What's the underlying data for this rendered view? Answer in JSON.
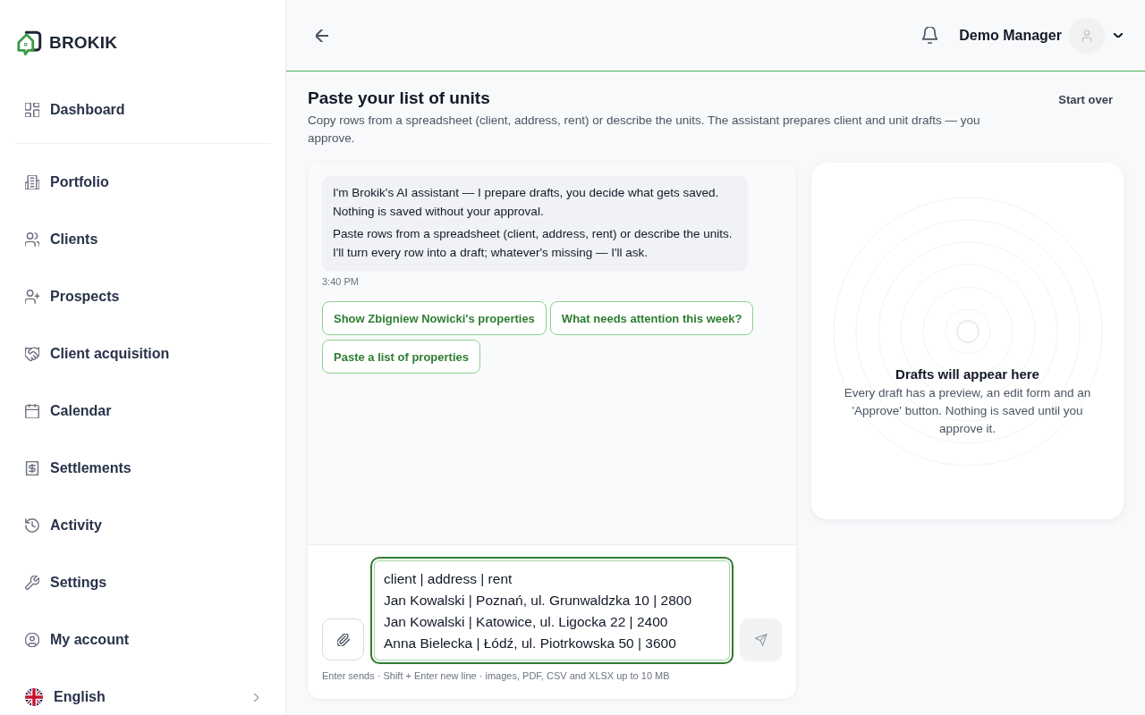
{
  "sidebar": {
    "logo": {
      "text": "BROKIK"
    },
    "nav_groups": [
      {
        "items": [
          {
            "label": "Dashboard",
            "selected": false
          }
        ]
      },
      {
        "items": [
          {
            "label": "Portfolio",
            "selected": false
          },
          {
            "label": "Clients",
            "selected": false
          },
          {
            "label": "Prospects",
            "selected": false
          },
          {
            "label": "Client acquisition",
            "selected": false
          },
          {
            "label": "Calendar",
            "selected": false
          },
          {
            "label": "Settlements",
            "selected": false
          },
          {
            "label": "Activity",
            "selected": false
          },
          {
            "label": "Settings",
            "selected": false
          },
          {
            "label": "My account",
            "selected": false
          }
        ]
      }
    ],
    "language": {
      "label": "English"
    }
  },
  "header": {
    "user_name": "Demo Manager"
  },
  "page": {
    "title": "Paste your list of units",
    "description": "Copy rows from a spreadsheet (client, address, rent) or describe the units. The assistant prepares client and unit drafts — you approve.",
    "start_over": "Start over"
  },
  "chat": {
    "messages": [
      {
        "paragraphs": [
          "I'm Brokik's AI assistant — I prepare drafts, you decide what gets saved. Nothing is saved without your approval.",
          "Paste rows from a spreadsheet (client, address, rent) or describe the units. I'll turn every row into a draft; whatever's missing — I'll ask."
        ],
        "time": "3:40 PM"
      }
    ],
    "suggestions": [
      "Show Zbigniew Nowicki's properties",
      "What needs attention this week?",
      "Paste a list of properties"
    ],
    "composer": {
      "value": "client | address | rent\nJan Kowalski | Poznań, ul. Grunwaldzka 10 | 2800\nJan Kowalski | Katowice, ul. Ligocka 22 | 2400\nAnna Bielecka | Łódź, ul. Piotrkowska 50 | 3600",
      "send_disabled": true,
      "hint": "Enter sends · Shift + Enter new line · images, PDF, CSV and XLSX up to 10 MB"
    }
  },
  "drafts": {
    "title": "Drafts will appear here",
    "description": "Every draft has a preview, an edit form and an 'Approve' button. Nothing is saved until you approve it."
  }
}
